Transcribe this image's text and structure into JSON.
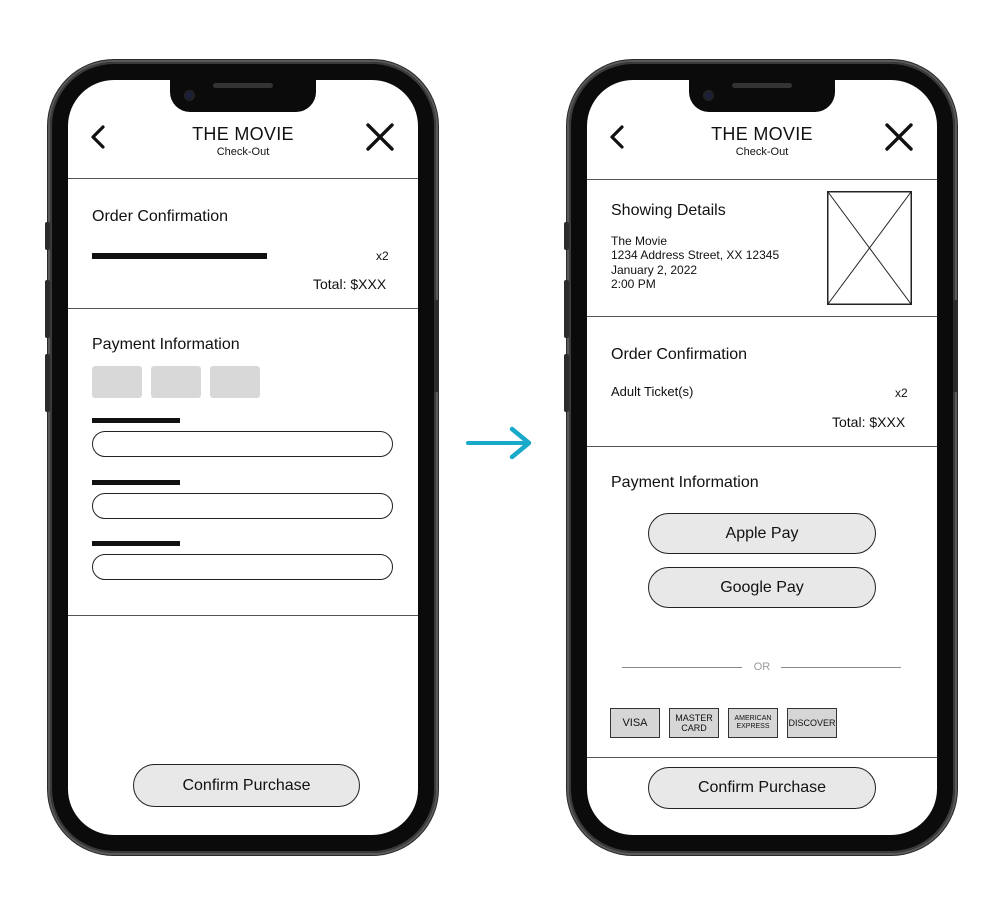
{
  "colors": {
    "arrow": "#19a9c9",
    "button_fill": "#e8e8e8",
    "card_fill": "#d6d6d6",
    "placeholder_fill": "#d8d8d8"
  },
  "left_screen": {
    "header": {
      "title": "THE MOVIE",
      "subtitle": "Check-Out"
    },
    "order": {
      "heading": "Order Confirmation",
      "quantity": "x2",
      "total": "Total: $XXX"
    },
    "payment": {
      "heading": "Payment Information"
    },
    "confirm_label": "Confirm Purchase"
  },
  "right_screen": {
    "header": {
      "title": "THE MOVIE",
      "subtitle": "Check-Out"
    },
    "showing": {
      "heading": "Showing Details",
      "lines": [
        "The Movie",
        "1234 Address Street, XX 12345",
        "January 2, 2022",
        "2:00 PM"
      ]
    },
    "order": {
      "heading": "Order Confirmation",
      "item": "Adult Ticket(s)",
      "quantity": "x2",
      "total": "Total: $XXX"
    },
    "payment": {
      "heading": "Payment Information",
      "apple_pay": "Apple Pay",
      "google_pay": "Google Pay",
      "or": "OR",
      "cards": {
        "visa": "VISA",
        "mastercard": "MASTER CARD",
        "amex": "AMERICAN EXPRESS",
        "discover": "DISCOVER"
      }
    },
    "confirm_label": "Confirm Purchase"
  }
}
